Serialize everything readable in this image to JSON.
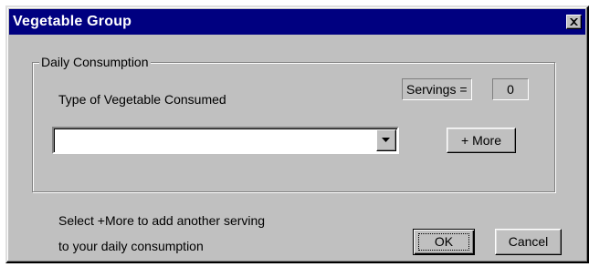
{
  "window": {
    "title": "Vegetable Group",
    "close_icon": "close-icon"
  },
  "group": {
    "legend": "Daily Consumption",
    "type_label": "Type of Vegetable Consumed",
    "servings_label": "Servings =",
    "servings_value": "0",
    "combo_value": "",
    "more_label": "+ More"
  },
  "footer": {
    "hint_line1": "Select +More to add another serving",
    "hint_line2": "to your daily consumption",
    "ok_label": "OK",
    "cancel_label": "Cancel"
  },
  "colors": {
    "titlebar": "#000080",
    "face": "#c0c0c0"
  }
}
